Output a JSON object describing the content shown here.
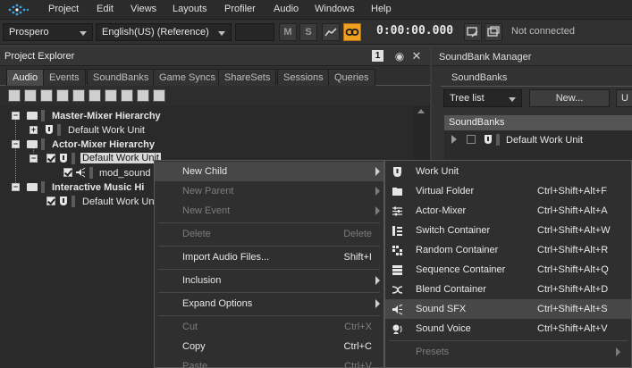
{
  "menubar": {
    "items": [
      "Project",
      "Edit",
      "Views",
      "Layouts",
      "Profiler",
      "Audio",
      "Windows",
      "Help"
    ]
  },
  "toolbar": {
    "platform": "Prospero",
    "language": "English(US) (Reference)",
    "mute_label": "M",
    "solo_label": "S",
    "timecode": "0:00:00.000",
    "connection_status": "Not connected"
  },
  "project_explorer": {
    "title": "Project Explorer",
    "help_label": "1",
    "tabs": [
      "Audio",
      "Events",
      "SoundBanks",
      "Game Syncs",
      "ShareSets",
      "Sessions",
      "Queries"
    ],
    "active_tab": "Audio",
    "tree": [
      {
        "label": "Master-Mixer Hierarchy",
        "bold": true
      },
      {
        "label": "Default Work Unit",
        "bold": false
      },
      {
        "label": "Actor-Mixer Hierarchy",
        "bold": true
      },
      {
        "label": "Default Work Unit",
        "bold": false,
        "selected": true
      },
      {
        "label": "mod_sound",
        "bold": false
      },
      {
        "label": "Interactive Music Hi",
        "bold": true
      },
      {
        "label": "Default Work Uni",
        "bold": false
      }
    ]
  },
  "soundbank_manager": {
    "title": "SoundBank Manager",
    "group_label": "SoundBanks",
    "view_select": "Tree list",
    "new_button": "New...",
    "extra_button": "U",
    "list_header": "SoundBanks",
    "items": [
      "Default Work Unit"
    ]
  },
  "context_menu": {
    "items": [
      {
        "label": "New Child",
        "shortcut": "",
        "disabled": false,
        "submenu": true
      },
      {
        "label": "New Parent",
        "shortcut": "",
        "disabled": true,
        "submenu": true
      },
      {
        "label": "New Event",
        "shortcut": "",
        "disabled": true,
        "submenu": true
      },
      {
        "label": "Delete",
        "shortcut": "Delete",
        "disabled": true,
        "submenu": false
      },
      {
        "label": "Import Audio Files...",
        "shortcut": "Shift+I",
        "disabled": false,
        "submenu": false
      },
      {
        "label": "Inclusion",
        "shortcut": "",
        "disabled": false,
        "submenu": true
      },
      {
        "label": "Expand Options",
        "shortcut": "",
        "disabled": false,
        "submenu": true
      },
      {
        "label": "Cut",
        "shortcut": "Ctrl+X",
        "disabled": true,
        "submenu": false
      },
      {
        "label": "Copy",
        "shortcut": "Ctrl+C",
        "disabled": false,
        "submenu": false
      },
      {
        "label": "Paste",
        "shortcut": "Ctrl+V",
        "disabled": true,
        "submenu": false
      }
    ]
  },
  "submenu": {
    "items": [
      {
        "label": "Work Unit",
        "shortcut": "",
        "icon": "work-unit-icon"
      },
      {
        "label": "Virtual Folder",
        "shortcut": "Ctrl+Shift+Alt+F",
        "icon": "virtual-folder-icon"
      },
      {
        "label": "Actor-Mixer",
        "shortcut": "Ctrl+Shift+Alt+A",
        "icon": "actor-mixer-icon"
      },
      {
        "label": "Switch Container",
        "shortcut": "Ctrl+Shift+Alt+W",
        "icon": "switch-container-icon"
      },
      {
        "label": "Random Container",
        "shortcut": "Ctrl+Shift+Alt+R",
        "icon": "random-container-icon"
      },
      {
        "label": "Sequence Container",
        "shortcut": "Ctrl+Shift+Alt+Q",
        "icon": "sequence-container-icon"
      },
      {
        "label": "Blend Container",
        "shortcut": "Ctrl+Shift+Alt+D",
        "icon": "blend-container-icon"
      },
      {
        "label": "Sound SFX",
        "shortcut": "Ctrl+Shift+Alt+S",
        "icon": "sound-sfx-icon"
      },
      {
        "label": "Sound Voice",
        "shortcut": "Ctrl+Shift+Alt+V",
        "icon": "sound-voice-icon"
      },
      {
        "label": "Presets",
        "shortcut": "",
        "icon": ""
      }
    ]
  },
  "colors": {
    "accent_orange": "#f0a020",
    "logo_blue": "#3aa6e6",
    "selection_bg": "#d9d9d9",
    "menu_hover": "#474747"
  }
}
